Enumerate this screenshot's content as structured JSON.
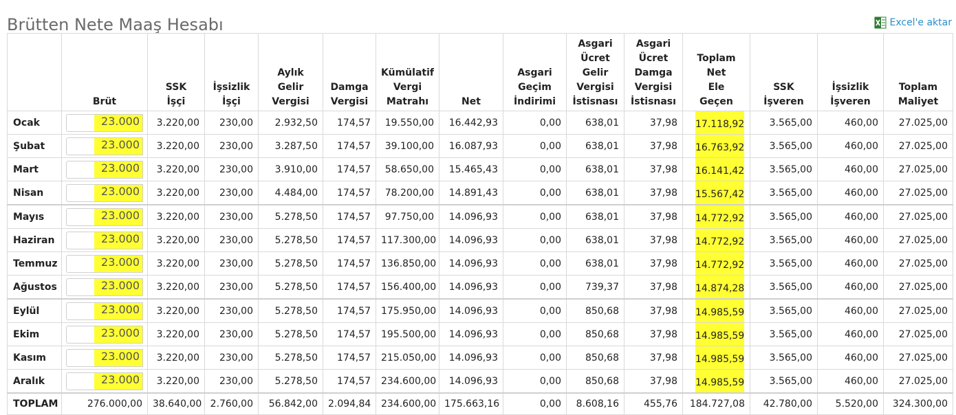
{
  "page": {
    "title": "Brütten Nete Maaş Hesabı",
    "export_label": "Excel'e aktar"
  },
  "colors": {
    "highlight": "#ffff33",
    "link": "#2a8fc9",
    "title": "#6a6a6a"
  },
  "icons": {
    "export": "excel-icon"
  },
  "table": {
    "headers": [
      {
        "key": "month",
        "label": ""
      },
      {
        "key": "brut",
        "label": "Brüt"
      },
      {
        "key": "ssk_isci",
        "label": "SSK İşçi"
      },
      {
        "key": "issizlik_isci",
        "label": "İşsizlik İşçi"
      },
      {
        "key": "gelir_vergisi",
        "label": "Aylık Gelir Vergisi"
      },
      {
        "key": "damga",
        "label": "Damga Vergisi"
      },
      {
        "key": "kumulatif",
        "label": "Kümülatif Vergi Matrahı"
      },
      {
        "key": "net",
        "label": "Net"
      },
      {
        "key": "agi",
        "label": "Asgari Geçim İndirimi"
      },
      {
        "key": "asg_gelir",
        "label": "Asgari Ücret Gelir Vergisi İstisnası"
      },
      {
        "key": "asg_damga",
        "label": "Asgari Ücret Damga Vergisi İstisnası"
      },
      {
        "key": "ele_gecen",
        "label": "Toplam Net Ele Geçen"
      },
      {
        "key": "ssk_isveren",
        "label": "SSK İşveren"
      },
      {
        "key": "issizlik_isveren",
        "label": "İşsizlik İşveren"
      },
      {
        "key": "maliyet",
        "label": "Toplam Maliyet"
      }
    ],
    "header_lines": [
      [
        ""
      ],
      [
        "Brüt"
      ],
      [
        "SSK",
        "İşçi"
      ],
      [
        "İşsizlik",
        "İşçi"
      ],
      [
        "Aylık",
        "Gelir",
        "Vergisi"
      ],
      [
        "Damga",
        "Vergisi"
      ],
      [
        "Kümülatif",
        "Vergi",
        "Matrahı"
      ],
      [
        "Net"
      ],
      [
        "Asgari",
        "Geçim",
        "İndirimi"
      ],
      [
        "Asgari",
        "Ücret",
        "Gelir",
        "Vergisi",
        "İstisnası"
      ],
      [
        "Asgari",
        "Ücret",
        "Damga",
        "Vergisi",
        "İstisnası"
      ],
      [
        "Toplam",
        "Net",
        "Ele",
        "Geçen"
      ],
      [
        "SSK",
        "İşveren"
      ],
      [
        "İşsizlik",
        "İşveren"
      ],
      [
        "Toplam",
        "Maliyet"
      ]
    ],
    "rows": [
      [
        "Ocak",
        "23.000",
        "3.220,00",
        "230,00",
        "2.932,50",
        "174,57",
        "19.550,00",
        "16.442,93",
        "0,00",
        "638,01",
        "37,98",
        "17.118,92",
        "3.565,00",
        "460,00",
        "27.025,00"
      ],
      [
        "Şubat",
        "23.000",
        "3.220,00",
        "230,00",
        "3.287,50",
        "174,57",
        "39.100,00",
        "16.087,93",
        "0,00",
        "638,01",
        "37,98",
        "16.763,92",
        "3.565,00",
        "460,00",
        "27.025,00"
      ],
      [
        "Mart",
        "23.000",
        "3.220,00",
        "230,00",
        "3.910,00",
        "174,57",
        "58.650,00",
        "15.465,43",
        "0,00",
        "638,01",
        "37,98",
        "16.141,42",
        "3.565,00",
        "460,00",
        "27.025,00"
      ],
      [
        "Nisan",
        "23.000",
        "3.220,00",
        "230,00",
        "4.484,00",
        "174,57",
        "78.200,00",
        "14.891,43",
        "0,00",
        "638,01",
        "37,98",
        "15.567,42",
        "3.565,00",
        "460,00",
        "27.025,00"
      ],
      [
        "Mayıs",
        "23.000",
        "3.220,00",
        "230,00",
        "5.278,50",
        "174,57",
        "97.750,00",
        "14.096,93",
        "0,00",
        "638,01",
        "37,98",
        "14.772,92",
        "3.565,00",
        "460,00",
        "27.025,00"
      ],
      [
        "Haziran",
        "23.000",
        "3.220,00",
        "230,00",
        "5.278,50",
        "174,57",
        "117.300,00",
        "14.096,93",
        "0,00",
        "638,01",
        "37,98",
        "14.772,92",
        "3.565,00",
        "460,00",
        "27.025,00"
      ],
      [
        "Temmuz",
        "23.000",
        "3.220,00",
        "230,00",
        "5.278,50",
        "174,57",
        "136.850,00",
        "14.096,93",
        "0,00",
        "638,01",
        "37,98",
        "14.772,92",
        "3.565,00",
        "460,00",
        "27.025,00"
      ],
      [
        "Ağustos",
        "23.000",
        "3.220,00",
        "230,00",
        "5.278,50",
        "174,57",
        "156.400,00",
        "14.096,93",
        "0,00",
        "739,37",
        "37,98",
        "14.874,28",
        "3.565,00",
        "460,00",
        "27.025,00"
      ],
      [
        "Eylül",
        "23.000",
        "3.220,00",
        "230,00",
        "5.278,50",
        "174,57",
        "175.950,00",
        "14.096,93",
        "0,00",
        "850,68",
        "37,98",
        "14.985,59",
        "3.565,00",
        "460,00",
        "27.025,00"
      ],
      [
        "Ekim",
        "23.000",
        "3.220,00",
        "230,00",
        "5.278,50",
        "174,57",
        "195.500,00",
        "14.096,93",
        "0,00",
        "850,68",
        "37,98",
        "14.985,59",
        "3.565,00",
        "460,00",
        "27.025,00"
      ],
      [
        "Kasım",
        "23.000",
        "3.220,00",
        "230,00",
        "5.278,50",
        "174,57",
        "215.050,00",
        "14.096,93",
        "0,00",
        "850,68",
        "37,98",
        "14.985,59",
        "3.565,00",
        "460,00",
        "27.025,00"
      ],
      [
        "Aralık",
        "23.000",
        "3.220,00",
        "230,00",
        "5.278,50",
        "174,57",
        "234.600,00",
        "14.096,93",
        "0,00",
        "850,68",
        "37,98",
        "14.985,59",
        "3.565,00",
        "460,00",
        "27.025,00"
      ]
    ],
    "total": [
      "TOPLAM",
      "276.000,00",
      "38.640,00",
      "2.760,00",
      "56.842,00",
      "2.094,84",
      "234.600,00",
      "175.663,16",
      "0,00",
      "8.608,16",
      "455,76",
      "184.727,08",
      "42.780,00",
      "5.520,00",
      "324.300,00"
    ]
  }
}
